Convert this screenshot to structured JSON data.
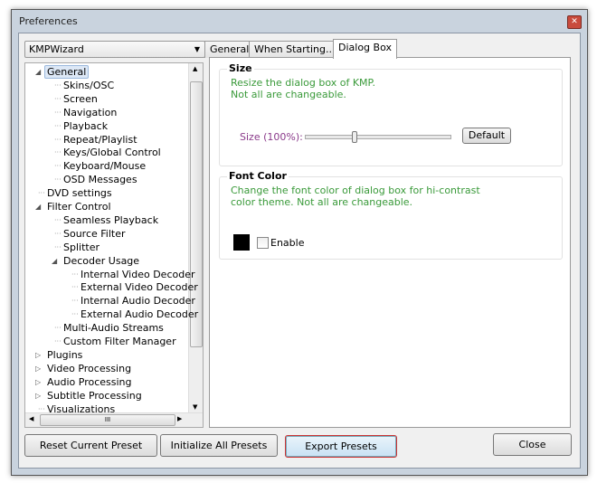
{
  "window": {
    "title": "Preferences"
  },
  "preset_combo": {
    "value": "KMPWizard"
  },
  "tree": [
    {
      "label": "General",
      "level": 0,
      "toggle": "expanded",
      "selected": true
    },
    {
      "label": "Skins/OSC",
      "level": 1
    },
    {
      "label": "Screen",
      "level": 1
    },
    {
      "label": "Navigation",
      "level": 1
    },
    {
      "label": "Playback",
      "level": 1
    },
    {
      "label": "Repeat/Playlist",
      "level": 1
    },
    {
      "label": "Keys/Global Control",
      "level": 1
    },
    {
      "label": "Keyboard/Mouse",
      "level": 1
    },
    {
      "label": "OSD Messages",
      "level": 1
    },
    {
      "label": "DVD settings",
      "level": 0
    },
    {
      "label": "Filter Control",
      "level": 0,
      "toggle": "expanded"
    },
    {
      "label": "Seamless Playback",
      "level": 1
    },
    {
      "label": "Source Filter",
      "level": 1
    },
    {
      "label": "Splitter",
      "level": 1
    },
    {
      "label": "Decoder Usage",
      "level": 1,
      "toggle": "expanded"
    },
    {
      "label": "Internal Video Decoder",
      "level": 2
    },
    {
      "label": "External Video Decoder",
      "level": 2
    },
    {
      "label": "Internal Audio Decoder",
      "level": 2
    },
    {
      "label": "External Audio Decoder",
      "level": 2
    },
    {
      "label": "Multi-Audio Streams",
      "level": 1
    },
    {
      "label": "Custom Filter Manager",
      "level": 1
    },
    {
      "label": "Plugins",
      "level": 0,
      "toggle": "collapsed"
    },
    {
      "label": "Video Processing",
      "level": 0,
      "toggle": "collapsed"
    },
    {
      "label": "Audio Processing",
      "level": 0,
      "toggle": "collapsed"
    },
    {
      "label": "Subtitle Processing",
      "level": 0,
      "toggle": "collapsed"
    },
    {
      "label": "Visualizations",
      "level": 0
    }
  ],
  "tabs": [
    "General",
    "When Starting...",
    "Dialog Box"
  ],
  "active_tab": "Dialog Box",
  "size_group": {
    "title": "Size",
    "desc1": "Resize the dialog box of KMP.",
    "desc2": "Not all are changeable.",
    "slider_label": "Size (100%):",
    "slider_value_fraction": 0.33,
    "default_btn": "Default"
  },
  "font_group": {
    "title": "Font Color",
    "desc1": "Change the font color of dialog box for hi-contrast",
    "desc2": "color theme. Not all are changeable.",
    "swatch_color": "#000000",
    "enable_label": "Enable",
    "enabled": false
  },
  "buttons": {
    "reset": "Reset Current Preset",
    "init": "Initialize All Presets",
    "export": "Export Presets",
    "close": "Close"
  }
}
